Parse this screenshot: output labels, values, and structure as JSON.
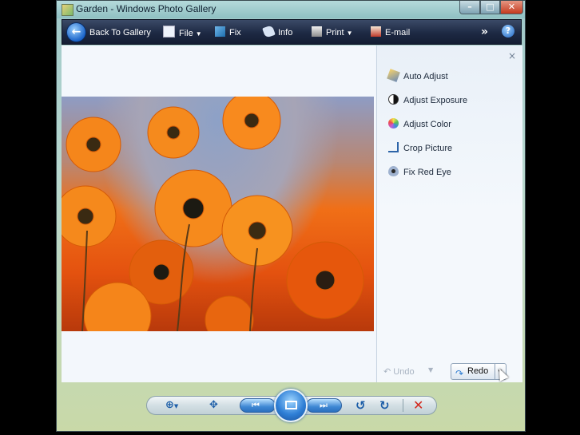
{
  "window": {
    "title": "Garden - Windows Photo Gallery",
    "controls": {
      "minimize": "–",
      "maximize": "□",
      "close": "✕"
    }
  },
  "toolbar": {
    "back_label": "Back To Gallery",
    "file_label": "File",
    "fix_label": "Fix",
    "info_label": "Info",
    "print_label": "Print",
    "email_label": "E-mail",
    "more_glyph": "»",
    "help_glyph": "?"
  },
  "fix_panel": {
    "close_glyph": "×",
    "items": [
      {
        "label": "Auto Adjust",
        "icon": "magic-wand-icon"
      },
      {
        "label": "Adjust Exposure",
        "icon": "exposure-icon"
      },
      {
        "label": "Adjust Color",
        "icon": "color-wheel-icon"
      },
      {
        "label": "Crop Picture",
        "icon": "crop-icon"
      },
      {
        "label": "Fix Red Eye",
        "icon": "eye-icon"
      }
    ],
    "undo_label": "Undo",
    "redo_label": "Redo"
  },
  "photo": {
    "subject": "orange daisies"
  },
  "colors": {
    "toolbar_bg": "#1d2943",
    "panel_bg": "#eef4fa",
    "accent_blue": "#2f7fd6",
    "delete_red": "#d3271c"
  }
}
